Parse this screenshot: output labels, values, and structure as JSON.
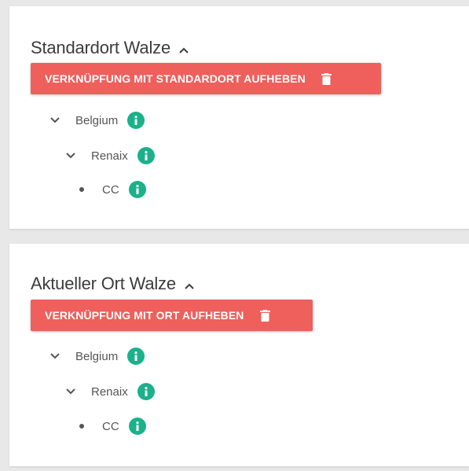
{
  "sections": [
    {
      "title": "Standardort Walze",
      "button_label": "VERKNÜPFUNG MIT STANDARDORT AUFHEBEN",
      "tree": [
        {
          "label": "Belgium",
          "type": "expanded"
        },
        {
          "label": "Renaix",
          "type": "expanded"
        },
        {
          "label": "CC",
          "type": "leaf"
        }
      ]
    },
    {
      "title": "Aktueller Ort Walze",
      "button_label": "VERKNÜPFUNG MIT ORT AUFHEBEN",
      "tree": [
        {
          "label": "Belgium",
          "type": "expanded"
        },
        {
          "label": "Renaix",
          "type": "expanded"
        },
        {
          "label": "CC",
          "type": "leaf"
        }
      ]
    }
  ],
  "colors": {
    "button": "#ef5f5b",
    "info": "#1bb18a",
    "background": "#e8e8e8"
  },
  "icons": [
    "chevron-up-icon",
    "trash-icon",
    "chevron-down-icon",
    "info-icon",
    "bullet-icon"
  ]
}
